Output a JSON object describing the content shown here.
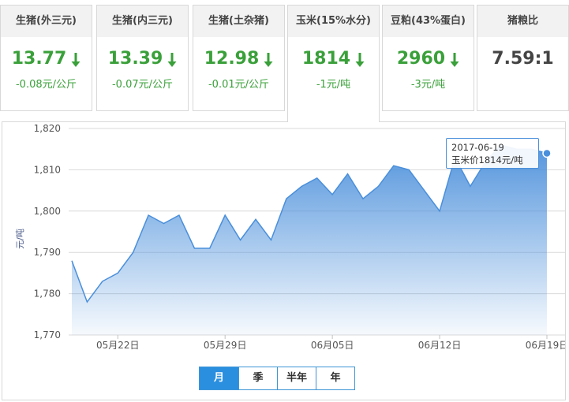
{
  "cards": [
    {
      "title": "生猪(外三元)",
      "value": "13.77",
      "change": "-0.08元/公斤",
      "trend": "down"
    },
    {
      "title": "生猪(内三元)",
      "value": "13.39",
      "change": "-0.07元/公斤",
      "trend": "down"
    },
    {
      "title": "生猪(土杂猪)",
      "value": "12.98",
      "change": "-0.01元/公斤",
      "trend": "down"
    },
    {
      "title": "玉米(15%水分)",
      "value": "1814",
      "change": "-1元/吨",
      "trend": "down",
      "active": true
    },
    {
      "title": "豆粕(43%蛋白)",
      "value": "2960",
      "change": "-3元/吨",
      "trend": "down"
    },
    {
      "title": "猪粮比",
      "value": "7.59:1",
      "change": "",
      "trend": "none"
    }
  ],
  "colors": {
    "down": "#3aa03a",
    "line": "#4a8fdb",
    "accent": "#2b8fe0"
  },
  "tooltip": {
    "date": "2017-06-19",
    "text": "玉米价1814元/吨"
  },
  "range_buttons": [
    {
      "label": "月",
      "active": true
    },
    {
      "label": "季",
      "active": false
    },
    {
      "label": "半年",
      "active": false
    },
    {
      "label": "年",
      "active": false
    }
  ],
  "chart_data": {
    "type": "area",
    "ylabel": "元/吨",
    "ylim": [
      1770,
      1820
    ],
    "yticks": [
      1770,
      1780,
      1790,
      1800,
      1810,
      1820
    ],
    "ytick_labels": [
      "1,770",
      "1,780",
      "1,790",
      "1,800",
      "1,810",
      "1,820"
    ],
    "x": [
      "2017-05-19",
      "2017-05-20",
      "2017-05-21",
      "2017-05-22",
      "2017-05-23",
      "2017-05-24",
      "2017-05-25",
      "2017-05-26",
      "2017-05-27",
      "2017-05-28",
      "2017-05-29",
      "2017-05-30",
      "2017-05-31",
      "2017-06-01",
      "2017-06-02",
      "2017-06-03",
      "2017-06-04",
      "2017-06-05",
      "2017-06-06",
      "2017-06-07",
      "2017-06-08",
      "2017-06-09",
      "2017-06-10",
      "2017-06-11",
      "2017-06-12",
      "2017-06-13",
      "2017-06-14",
      "2017-06-15",
      "2017-06-16",
      "2017-06-17",
      "2017-06-18",
      "2017-06-19"
    ],
    "values": [
      1788,
      1778,
      1783,
      1785,
      1790,
      1799,
      1797,
      1799,
      1791,
      1791,
      1799,
      1793,
      1798,
      1793,
      1803,
      1806,
      1808,
      1804,
      1809,
      1803,
      1806,
      1811,
      1810,
      1805,
      1800,
      1813,
      1806,
      1812,
      1816,
      1815,
      1815,
      1814
    ],
    "xtick_labels": [
      {
        "label": "05月22日",
        "date": "2017-05-22"
      },
      {
        "label": "05月29日",
        "date": "2017-05-29"
      },
      {
        "label": "06月05日",
        "date": "2017-06-05"
      },
      {
        "label": "06月12日",
        "date": "2017-06-12"
      },
      {
        "label": "06月19日",
        "date": "2017-06-19"
      }
    ],
    "grid": true,
    "highlight_date": "2017-06-19"
  }
}
